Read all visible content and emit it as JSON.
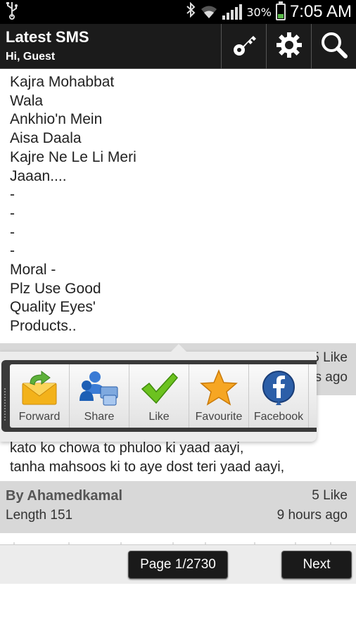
{
  "status_bar": {
    "battery": "30%",
    "time": "7:05 AM",
    "battery_level": 0.3,
    "icons": [
      "usb-icon",
      "bluetooth-icon",
      "wifi-icon",
      "signal-icon",
      "battery-charging-icon"
    ]
  },
  "action_bar": {
    "title": "Latest SMS",
    "subtitle": "Hi, Guest",
    "buttons": [
      "key-icon",
      "gear-icon",
      "search-icon"
    ]
  },
  "message1": {
    "lines": [
      "Kajra Mohabbat",
      "Wala",
      "Ankhio'n Mein",
      "Aisa Daala",
      "Kajre Ne Le Li Meri",
      "Jaaan....",
      "-",
      "-",
      "-",
      "-",
      "Moral -",
      "Plz Use Good",
      "Quality Eyes'",
      "Products.."
    ]
  },
  "meta1": {
    "likes": "5 Like",
    "time_ago": "s ago"
  },
  "quick_actions": {
    "items": [
      {
        "label": "Forward",
        "icon": "envelope-forward-icon"
      },
      {
        "label": "Share",
        "icon": "people-share-icon"
      },
      {
        "label": "Like",
        "icon": "checkmark-icon"
      },
      {
        "label": "Favourite",
        "icon": "star-icon"
      },
      {
        "label": "Facebook",
        "icon": "facebook-icon"
      }
    ]
  },
  "message2": {
    "lines": [
      "kato ko chowa to phuloo ki yaad aayi,",
      "tanha mahsoos ki to aye dost teri yaad aayi,"
    ]
  },
  "meta2": {
    "author": "By Ahamedkamal",
    "length": "Length 151",
    "likes": "5 Like",
    "time_ago": "9 hours ago"
  },
  "footer": {
    "page": "Page 1/2730",
    "next": "Next"
  },
  "colors": {
    "action_bar_bg": "#1b1b1b",
    "meta_bg": "#d8d8d8",
    "button_bg": "#1a1a1a",
    "star": "#f6a623",
    "check": "#6cc21f",
    "facebook": "#2c5fa8"
  }
}
